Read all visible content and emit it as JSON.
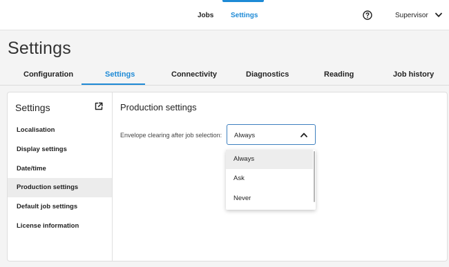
{
  "topnav": {
    "items": [
      {
        "label": "Jobs"
      },
      {
        "label": "Settings",
        "active": true
      }
    ],
    "help_icon": "help-circle-icon",
    "user": "Supervisor",
    "user_menu_icon": "chevron-down-icon"
  },
  "page": {
    "title": "Settings"
  },
  "tabs": [
    {
      "label": "Configuration"
    },
    {
      "label": "Settings",
      "active": true
    },
    {
      "label": "Connectivity"
    },
    {
      "label": "Diagnostics"
    },
    {
      "label": "Reading"
    },
    {
      "label": "Job history"
    }
  ],
  "sidebar": {
    "title": "Settings",
    "open_icon": "external-link-icon",
    "items": [
      {
        "label": "Localisation"
      },
      {
        "label": "Display settings"
      },
      {
        "label": "Date/time"
      },
      {
        "label": "Production settings",
        "active": true
      },
      {
        "label": "Default job settings"
      },
      {
        "label": "License information"
      }
    ]
  },
  "content": {
    "title": "Production settings",
    "envelope_clearing": {
      "label": "Envelope clearing after job selection:",
      "value": "Always",
      "expanded": true,
      "options": [
        "Always",
        "Ask",
        "Never"
      ],
      "highlighted_option": "Always"
    }
  },
  "colors": {
    "accent": "#1e8ad6",
    "active_item_bg": "#ececec",
    "page_bg": "#f4f4f4"
  }
}
